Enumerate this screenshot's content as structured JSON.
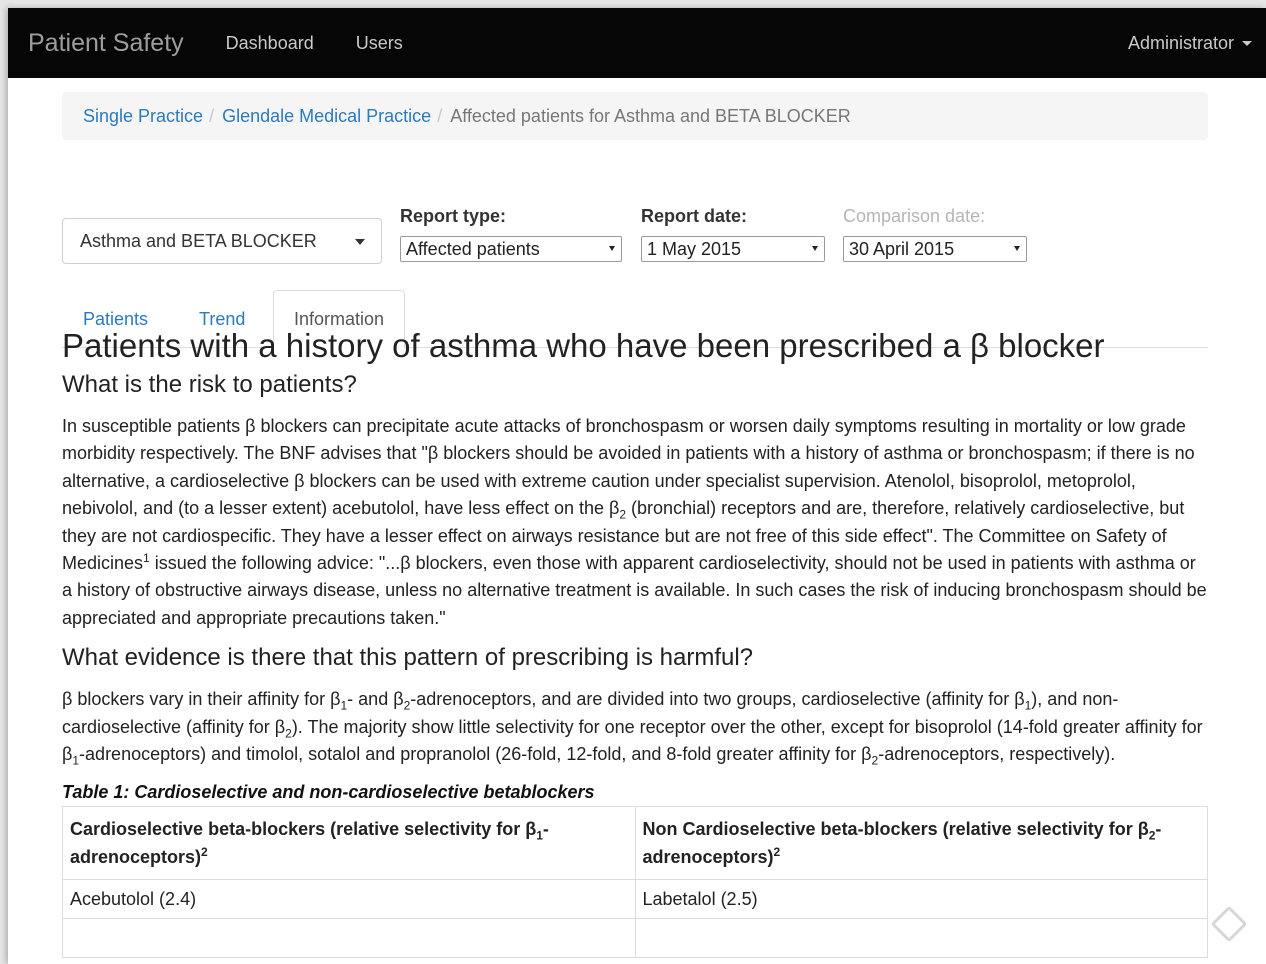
{
  "navbar": {
    "brand": "Patient Safety",
    "links": [
      "Dashboard",
      "Users"
    ],
    "user": "Administrator"
  },
  "breadcrumb": {
    "items": [
      "Single Practice",
      "Glendale Medical Practice"
    ],
    "active": "Affected patients for Asthma and BETA BLOCKER"
  },
  "controls": {
    "indicator": "Asthma and BETA BLOCKER",
    "report_type_label": "Report type:",
    "report_type_value": "Affected patients",
    "report_date_label": "Report date:",
    "report_date_value": "1 May 2015",
    "comparison_date_label": "Comparison date:",
    "comparison_date_value": "30 April 2015"
  },
  "tabs": [
    "Patients",
    "Trend",
    "Information"
  ],
  "info": {
    "title": "Patients with a history of asthma who have been prescribed a β blocker",
    "risk_heading": "What is the risk to patients?",
    "risk_text_1": "In susceptible patients β blockers can precipitate acute attacks of bronchospasm or worsen daily symptoms resulting in mortality or low grade morbidity respectively. The BNF advises that \"β blockers should be avoided in patients with a history of asthma or bronchospasm; if there is no alternative, a cardioselective β blockers can be used with extreme caution under specialist supervision. Atenolol, bisoprolol, metoprolol, nebivolol, and (to a lesser extent) acebutolol, have less effect on the β",
    "risk_sub_1": "2",
    "risk_text_2": " (bronchial) receptors and are, therefore, relatively cardioselective, but they are not cardiospecific. They have a lesser effect on airways resistance but are not free of this side effect\". The Committee on Safety of Medicines",
    "risk_sup_1": "1",
    "risk_text_3": " issued the following advice: \"...β blockers, even those with apparent cardioselectivity, should not be used in patients with asthma or a history of obstructive airways disease, unless no alternative treatment is available. In such cases the risk of inducing bronchospasm should be appreciated and appropriate precautions taken.\"",
    "evidence_heading": "What evidence is there that this pattern of prescribing is harmful?",
    "ev_1": "β blockers vary in their affinity for β",
    "ev_sub_1": "1",
    "ev_2": "- and β",
    "ev_sub_2": "2",
    "ev_3": "-adrenoceptors, and are divided into two groups, cardioselective (affinity for β",
    "ev_sub_3": "1",
    "ev_4": "), and non-cardioselective (affinity for β",
    "ev_sub_4": "2",
    "ev_5": "). The majority show little selectivity for one receptor over the other, except for bisoprolol (14-fold greater affinity for β",
    "ev_sub_5": "1",
    "ev_6": "-adrenoceptors) and timolol, sotalol and propranolol (26-fold, 12-fold, and 8-fold greater affinity for β",
    "ev_sub_6": "2",
    "ev_7": "-adrenoceptors, respectively).",
    "table_caption": "Table 1: Cardioselective and non-cardioselective betablockers",
    "table": {
      "col1_text": "Cardioselective beta-blockers (relative selectivity for β",
      "col1_sub": "1",
      "col1_tail": "-adrenoceptors)",
      "col1_sup": "2",
      "col2_text": "Non Cardioselective beta-blockers (relative selectivity for β",
      "col2_sub": "2",
      "col2_tail": "-adrenoceptors)",
      "col2_sup": "2",
      "rows": [
        [
          "Acebutolol (2.4)",
          "Labetalol (2.5)"
        ]
      ]
    }
  }
}
